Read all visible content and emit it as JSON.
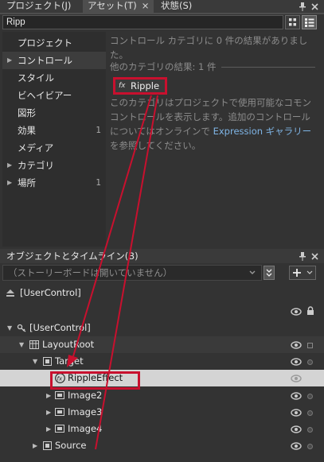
{
  "tabs": [
    {
      "label": "プロジェクト(J)"
    },
    {
      "label": "アセット(T)",
      "close": "×"
    },
    {
      "label": "状態(S)"
    }
  ],
  "assets": {
    "search_value": "Ripp",
    "categories": [
      {
        "label": "プロジェクト",
        "arrow": "",
        "count": ""
      },
      {
        "label": "コントロール",
        "arrow": "▶",
        "count": ""
      },
      {
        "label": "スタイル",
        "arrow": "",
        "count": ""
      },
      {
        "label": "ビヘイビアー",
        "arrow": "",
        "count": ""
      },
      {
        "label": "図形",
        "arrow": "",
        "count": ""
      },
      {
        "label": "効果",
        "arrow": "",
        "count": "1"
      },
      {
        "label": "メディア",
        "arrow": "",
        "count": ""
      },
      {
        "label": "カテゴリ",
        "arrow": "▶",
        "count": ""
      },
      {
        "label": "場所",
        "arrow": "▶",
        "count": "1"
      }
    ],
    "results_message": "コントロール カテゴリに 0 件の結果がありました。",
    "other_categories_header": "他のカテゴリの結果: 1 件",
    "result_item": {
      "icon": "fx",
      "label": "Ripple"
    },
    "desc_before": "このカテゴリはプロジェクトで使用可能なコモン コントロールを表示します。追加のコントロールについてはオンラインで ",
    "desc_link": "Expression ギャラリー",
    "desc_after": " を参照してください。"
  },
  "objects_panel": {
    "title": "オブジェクトとタイムライン(B)",
    "storyboard_text": "（ストーリーボードは開いていません）",
    "user_control_header": "[UserControl]",
    "tree": [
      {
        "label": "[UserControl]",
        "twisty": "▼"
      },
      {
        "label": "LayoutRoot",
        "twisty": "▼"
      },
      {
        "label": "Target",
        "twisty": "▼"
      },
      {
        "label": "RippleEffect",
        "twisty": ""
      },
      {
        "label": "Image2",
        "twisty": "▶"
      },
      {
        "label": "Image3",
        "twisty": "▶"
      },
      {
        "label": "Image4",
        "twisty": "▶"
      },
      {
        "label": "Source",
        "twisty": "▶"
      }
    ]
  },
  "colors": {
    "highlight": "#c8102e",
    "panel_bg": "#333333",
    "link": "#7fb5e6",
    "selected_row": "#d4d4d4"
  }
}
